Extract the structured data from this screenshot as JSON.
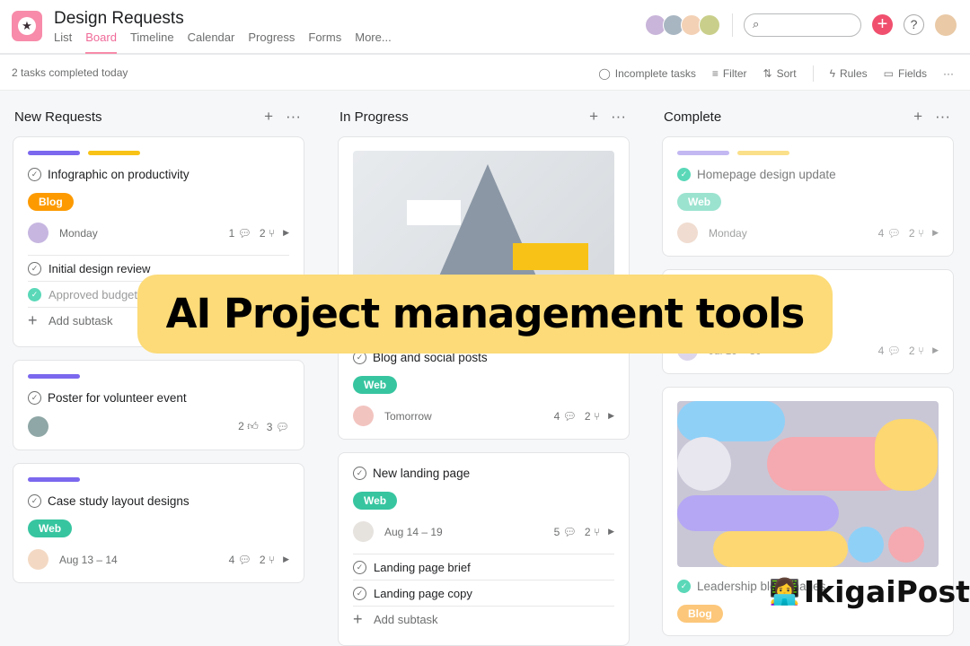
{
  "header": {
    "title": "Design Requests",
    "logo_icon": "star-icon",
    "tabs": [
      {
        "label": "List"
      },
      {
        "label": "Board",
        "active": true
      },
      {
        "label": "Timeline"
      },
      {
        "label": "Calendar"
      },
      {
        "label": "Progress"
      },
      {
        "label": "Forms"
      },
      {
        "label": "More..."
      }
    ],
    "members": [
      "#c9b5d9",
      "#a8b6c2",
      "#f3d1b5",
      "#c9cf8a"
    ],
    "search": {
      "placeholder": ""
    }
  },
  "toolbar": {
    "status": "2 tasks completed today",
    "actions": [
      {
        "icon": "check-circle-icon",
        "glyph": "◯",
        "label": "Incomplete tasks"
      },
      {
        "icon": "filter-icon",
        "glyph": "≡",
        "label": "Filter"
      },
      {
        "icon": "sort-icon",
        "glyph": "⇅",
        "label": "Sort"
      },
      {
        "sep": true
      },
      {
        "icon": "lightning-icon",
        "glyph": "ϟ",
        "label": "Rules"
      },
      {
        "icon": "fields-icon",
        "glyph": "▭",
        "label": "Fields"
      }
    ]
  },
  "colors": {
    "purple": "#7b68ee",
    "yellow": "#f8c316",
    "blog": "#fd9a00",
    "web": "#37c5a0"
  },
  "columns": [
    {
      "name": "New Requests",
      "cards": [
        {
          "bars": [
            "#7b68ee",
            "#f8c316"
          ],
          "title": "Infographic on productivity",
          "tag": "Blog",
          "tag_color": "#fd9a00",
          "avatar": "#c6b6e0",
          "date": "Monday",
          "comments": "1",
          "subtasks": "2",
          "subs": [
            {
              "label": "Initial design review"
            },
            {
              "label": "Approved budget",
              "done": true
            }
          ],
          "add_subtask": "Add subtask"
        },
        {
          "bars": [
            "#7b68ee"
          ],
          "title": "Poster for volunteer event",
          "avatar": "#8fa7a6",
          "date": "",
          "likes": "2",
          "comments": "3"
        },
        {
          "bars": [
            "#7b68ee"
          ],
          "title": "Case study layout designs",
          "tag": "Web",
          "tag_color": "#37c5a0",
          "avatar": "#f3d9c4",
          "date": "Aug 13 – 14",
          "comments": "4",
          "subtasks": "2"
        }
      ]
    },
    {
      "name": "In Progress",
      "cards": [
        {
          "image": "mountain",
          "title": "Blog and social posts",
          "tag": "Web",
          "tag_color": "#37c5a0",
          "avatar": "#f2c4c0",
          "date": "Tomorrow",
          "comments": "4",
          "subtasks": "2"
        },
        {
          "title": "New landing page",
          "tag": "Web",
          "tag_color": "#37c5a0",
          "avatar": "#e6e2de",
          "date": "Aug 14 – 19",
          "comments": "5",
          "subtasks": "2",
          "subs": [
            {
              "label": "Landing page brief"
            },
            {
              "label": "Landing page copy"
            }
          ],
          "add_subtask": "Add subtask"
        }
      ]
    },
    {
      "name": "Complete",
      "cards": [
        {
          "bars": [
            "#c3b8f2",
            "#fbe08a"
          ],
          "title": "Homepage design update",
          "done": true,
          "tag": "Web",
          "tag_color": "#9be3cf",
          "avatar": "#f0dcd0",
          "date": "Monday",
          "comments": "4",
          "subtasks": "2",
          "faded": true
        },
        {
          "title": "",
          "done": true,
          "avatar": "#ddd6ea",
          "date": "Jul 19 – 30",
          "comments": "4",
          "subtasks": "2",
          "faded": true
        },
        {
          "image": "pattern",
          "title": "Leadership blog images",
          "done": true,
          "tag": "Blog",
          "tag_color": "#fcc77a",
          "faded": true
        }
      ]
    }
  ],
  "banner": "AI Project management tools",
  "watermark": "IkigaiPost"
}
